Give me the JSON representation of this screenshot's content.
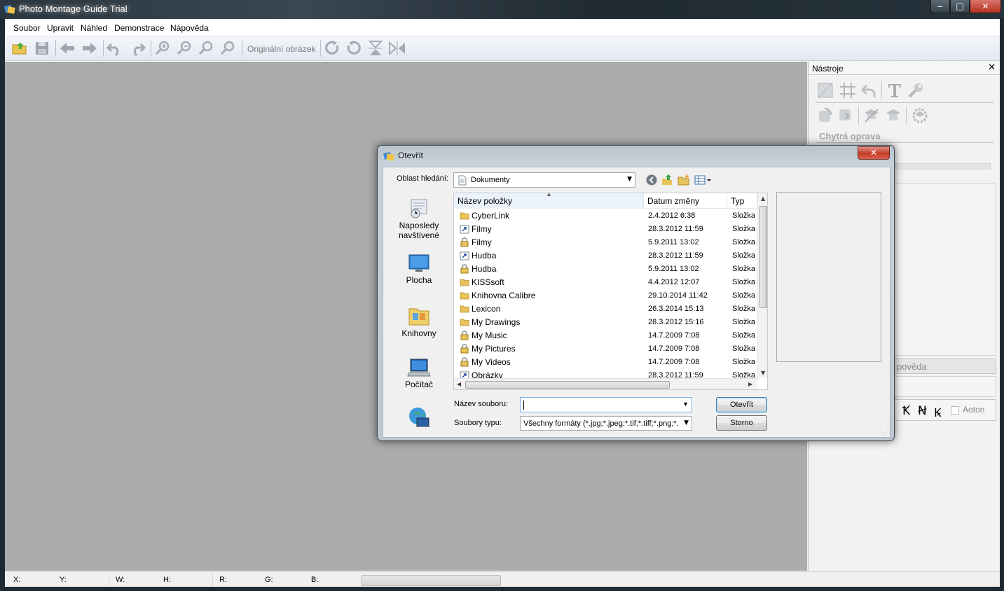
{
  "window": {
    "title": "Photo Montage Guide Trial",
    "controls": {
      "minimize": "‒",
      "maximize": "□",
      "close": "✕"
    }
  },
  "menu": [
    "Soubor",
    "Upravit",
    "Náhled",
    "Demonstrace",
    "Nápověda"
  ],
  "toolbar": {
    "original_label": "Originální obrázek",
    "icons": [
      "open-folder-icon",
      "save-icon",
      "back-arrow-icon",
      "forward-arrow-icon",
      "undo-icon",
      "redo-icon",
      "zoom-in-icon",
      "zoom-out-icon",
      "zoom-fit-icon",
      "zoom-actual-icon",
      "rotate-right-icon",
      "rotate-left-icon",
      "flip-vertical-icon",
      "flip-horizontal-icon"
    ]
  },
  "tools_panel": {
    "title": "Nástroje",
    "close": "✕",
    "smart_fix": "Chytrá oprava",
    "help_button": "pověda",
    "auto_label": "Aoton",
    "bezier_glyphs": [
      "Ꝁ",
      "Ꞥ",
      "Ꝃ"
    ]
  },
  "status_bar": {
    "x": "X:",
    "y": "Y:",
    "w": "W:",
    "h": "H:",
    "r": "R:",
    "g": "G:",
    "b": "B:"
  },
  "dialog": {
    "title": "Otevřít",
    "close": "✕",
    "look_in_label": "Oblast hledání:",
    "look_in_value": "Dokumenty",
    "places": [
      {
        "label_line1": "Naposledy",
        "label_line2": "navštívené",
        "icon": "recent-places-icon"
      },
      {
        "label_line1": "Plocha",
        "label_line2": "",
        "icon": "desktop-icon"
      },
      {
        "label_line1": "Knihovny",
        "label_line2": "",
        "icon": "libraries-icon"
      },
      {
        "label_line1": "Počítač",
        "label_line2": "",
        "icon": "computer-icon"
      },
      {
        "label_line1": "",
        "label_line2": "",
        "icon": "network-icon"
      }
    ],
    "columns": {
      "name": "Název položky",
      "date": "Datum změny",
      "type": "Typ"
    },
    "files": [
      {
        "name": "CyberLink",
        "date": "2.4.2012 6:38",
        "type": "Složka",
        "icon": "folder"
      },
      {
        "name": "Filmy",
        "date": "28.3.2012 11:59",
        "type": "Složka",
        "icon": "shortcut"
      },
      {
        "name": "Filmy",
        "date": "5.9.2011 13:02",
        "type": "Složka",
        "icon": "locked"
      },
      {
        "name": "Hudba",
        "date": "28.3.2012 11:59",
        "type": "Složka",
        "icon": "shortcut"
      },
      {
        "name": "Hudba",
        "date": "5.9.2011 13:02",
        "type": "Složka",
        "icon": "locked"
      },
      {
        "name": "KISSsoft",
        "date": "4.4.2012 12:07",
        "type": "Složka",
        "icon": "folder"
      },
      {
        "name": "Knihovna Calibre",
        "date": "29.10.2014 11:42",
        "type": "Složka",
        "icon": "folder"
      },
      {
        "name": "Lexicon",
        "date": "26.3.2014 15:13",
        "type": "Složka",
        "icon": "folder"
      },
      {
        "name": "My Drawings",
        "date": "28.3.2012 15:16",
        "type": "Složka",
        "icon": "folder"
      },
      {
        "name": "My Music",
        "date": "14.7.2009 7:08",
        "type": "Složka",
        "icon": "locked"
      },
      {
        "name": "My Pictures",
        "date": "14.7.2009 7:08",
        "type": "Složka",
        "icon": "locked"
      },
      {
        "name": "My Videos",
        "date": "14.7.2009 7:08",
        "type": "Složka",
        "icon": "locked"
      },
      {
        "name": "Obrázky",
        "date": "28.3.2012 11:59",
        "type": "Složka",
        "icon": "shortcut"
      }
    ],
    "file_name_label": "Název souboru:",
    "file_name_value": "",
    "file_type_label": "Soubory typu:",
    "file_type_value": "Všechny formáty (*.jpg;*.jpeg;*.tif;*.tiff;*.png;*.bn",
    "open_button": "Otevřít",
    "cancel_button": "Storno",
    "colors": {
      "folder": "#e8c25a",
      "accent": "#3c7fb1",
      "close": "#c33c27"
    }
  }
}
